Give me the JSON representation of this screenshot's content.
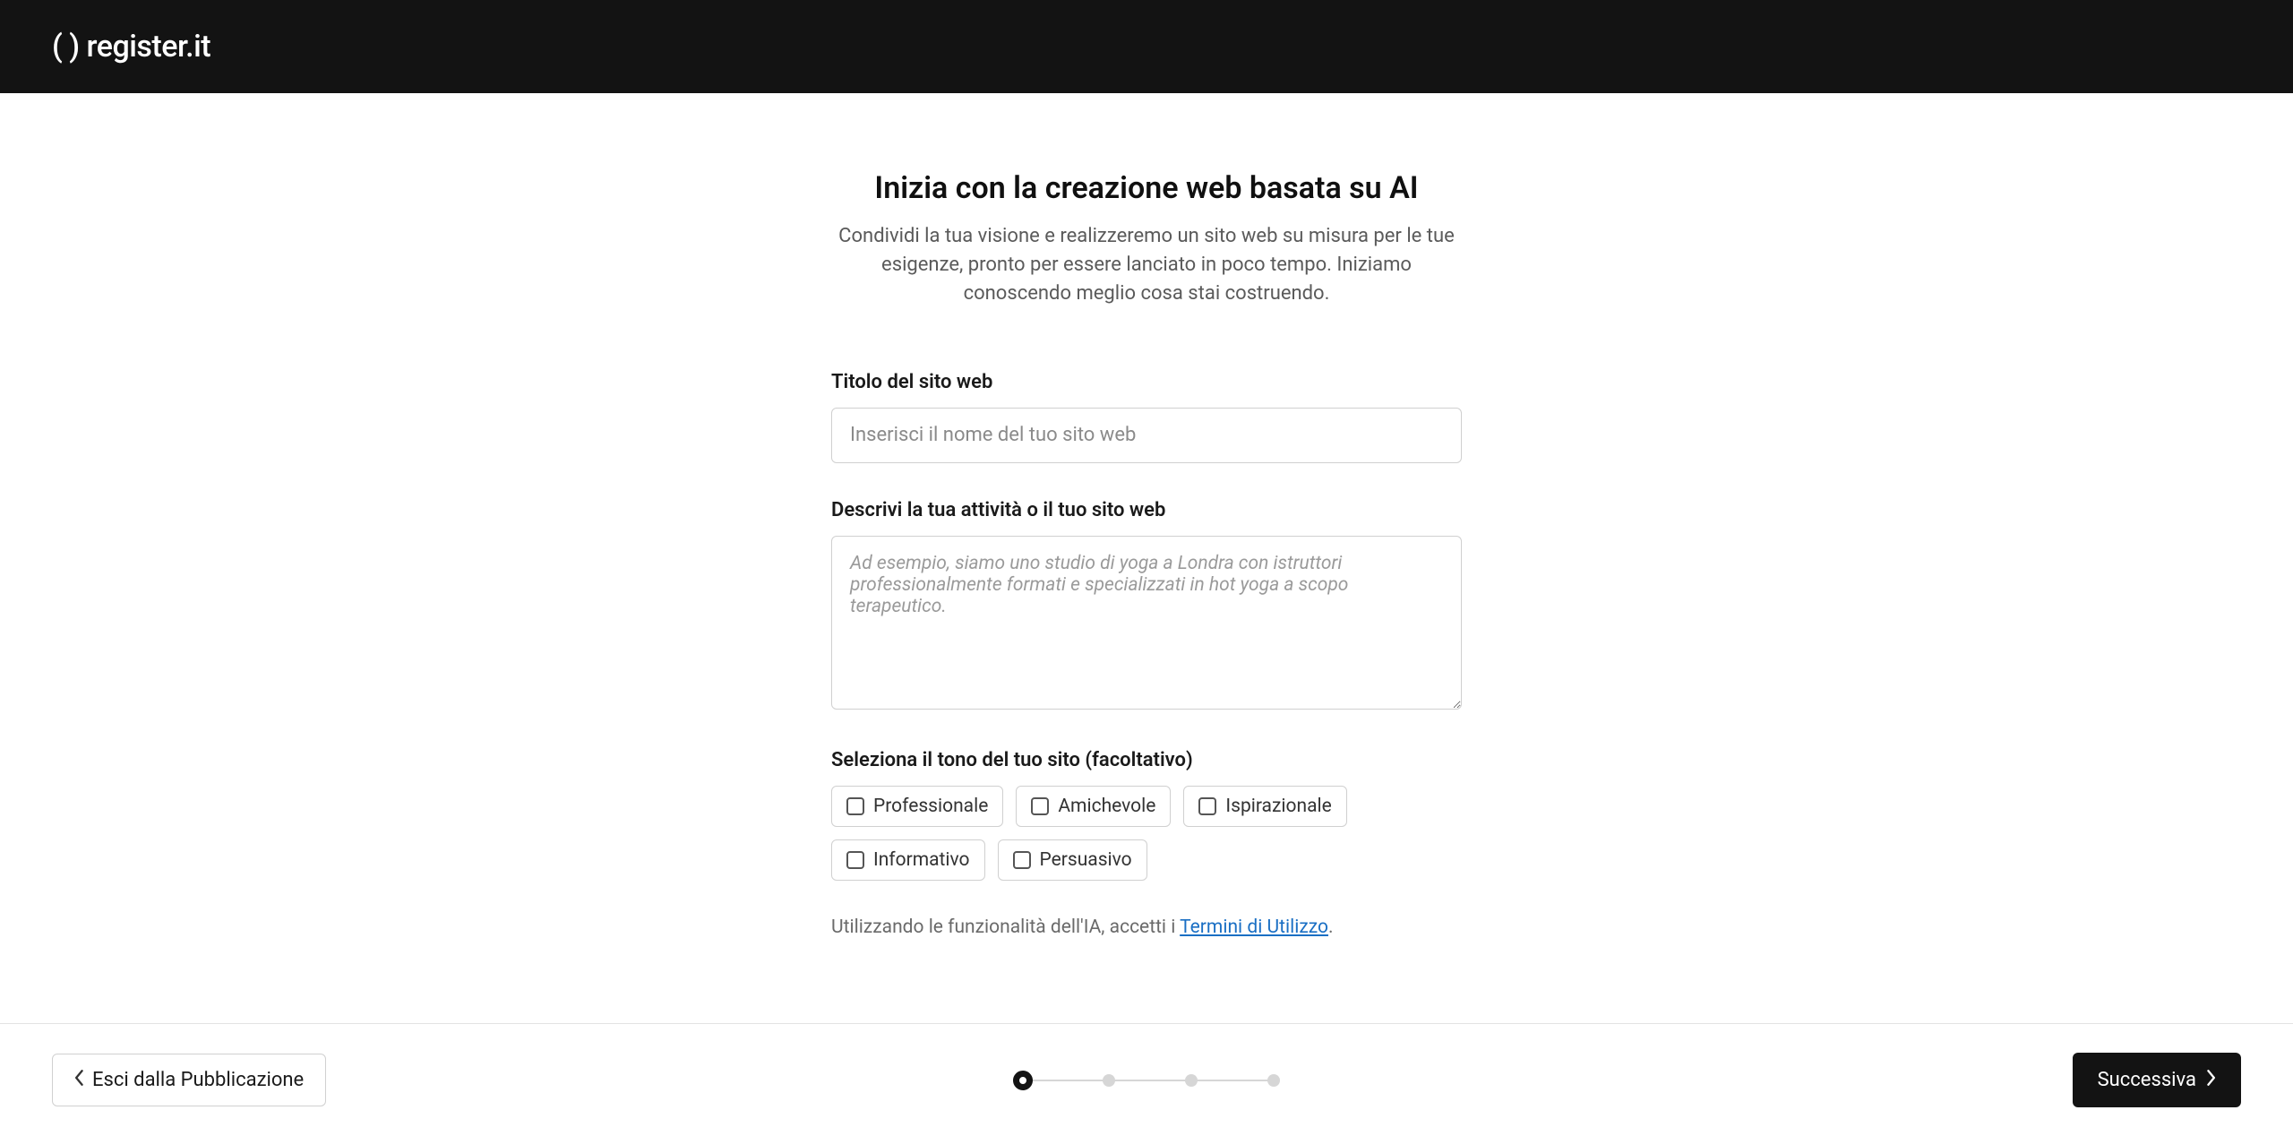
{
  "header": {
    "logo_text": "( ) register.it"
  },
  "main": {
    "title": "Inizia con la creazione web basata su AI",
    "subtitle": "Condividi la tua visione e realizzeremo un sito web su misura per le tue esigenze, pronto per essere lanciato in poco tempo. Iniziamo conoscendo meglio cosa stai costruendo.",
    "title_field": {
      "label": "Titolo del sito web",
      "placeholder": "Inserisci il nome del tuo sito web",
      "value": ""
    },
    "description_field": {
      "label": "Descrivi la tua attività o il tuo sito web",
      "placeholder": "Ad esempio, siamo uno studio di yoga a Londra con istruttori professionalmente formati e specializzati in hot yoga a scopo terapeutico.",
      "value": ""
    },
    "tone_field": {
      "label": "Seleziona il tono del tuo sito (facoltativo)",
      "options": [
        "Professionale",
        "Amichevole",
        "Ispirazionale",
        "Informativo",
        "Persuasivo"
      ]
    },
    "terms": {
      "prefix": "Utilizzando le funzionalità dell'IA, accetti i ",
      "link": "Termini di Utilizzo",
      "suffix": "."
    }
  },
  "footer": {
    "exit_label": "Esci dalla Pubblicazione",
    "next_label": "Successiva",
    "step_count": 4,
    "active_step": 0
  }
}
